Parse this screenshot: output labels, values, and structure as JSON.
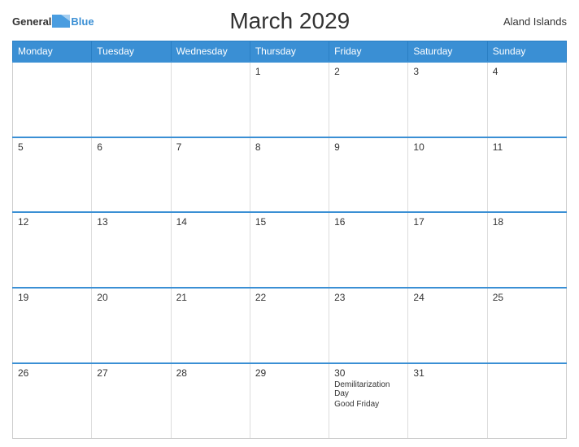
{
  "header": {
    "logo_general": "General",
    "logo_blue": "Blue",
    "title": "March 2029",
    "region": "Aland Islands"
  },
  "days_of_week": [
    "Monday",
    "Tuesday",
    "Wednesday",
    "Thursday",
    "Friday",
    "Saturday",
    "Sunday"
  ],
  "weeks": [
    [
      {
        "day": "",
        "empty": true
      },
      {
        "day": "",
        "empty": true
      },
      {
        "day": "",
        "empty": true
      },
      {
        "day": "1",
        "empty": false,
        "events": []
      },
      {
        "day": "2",
        "empty": false,
        "events": []
      },
      {
        "day": "3",
        "empty": false,
        "events": []
      },
      {
        "day": "4",
        "empty": false,
        "events": []
      }
    ],
    [
      {
        "day": "5",
        "empty": false,
        "events": []
      },
      {
        "day": "6",
        "empty": false,
        "events": []
      },
      {
        "day": "7",
        "empty": false,
        "events": []
      },
      {
        "day": "8",
        "empty": false,
        "events": []
      },
      {
        "day": "9",
        "empty": false,
        "events": []
      },
      {
        "day": "10",
        "empty": false,
        "events": []
      },
      {
        "day": "11",
        "empty": false,
        "events": []
      }
    ],
    [
      {
        "day": "12",
        "empty": false,
        "events": []
      },
      {
        "day": "13",
        "empty": false,
        "events": []
      },
      {
        "day": "14",
        "empty": false,
        "events": []
      },
      {
        "day": "15",
        "empty": false,
        "events": []
      },
      {
        "day": "16",
        "empty": false,
        "events": []
      },
      {
        "day": "17",
        "empty": false,
        "events": []
      },
      {
        "day": "18",
        "empty": false,
        "events": []
      }
    ],
    [
      {
        "day": "19",
        "empty": false,
        "events": []
      },
      {
        "day": "20",
        "empty": false,
        "events": []
      },
      {
        "day": "21",
        "empty": false,
        "events": []
      },
      {
        "day": "22",
        "empty": false,
        "events": []
      },
      {
        "day": "23",
        "empty": false,
        "events": []
      },
      {
        "day": "24",
        "empty": false,
        "events": []
      },
      {
        "day": "25",
        "empty": false,
        "events": []
      }
    ],
    [
      {
        "day": "26",
        "empty": false,
        "events": []
      },
      {
        "day": "27",
        "empty": false,
        "events": []
      },
      {
        "day": "28",
        "empty": false,
        "events": []
      },
      {
        "day": "29",
        "empty": false,
        "events": []
      },
      {
        "day": "30",
        "empty": false,
        "events": [
          "Demilitarization Day",
          "Good Friday"
        ]
      },
      {
        "day": "31",
        "empty": false,
        "events": []
      },
      {
        "day": "",
        "empty": true,
        "events": []
      }
    ]
  ]
}
